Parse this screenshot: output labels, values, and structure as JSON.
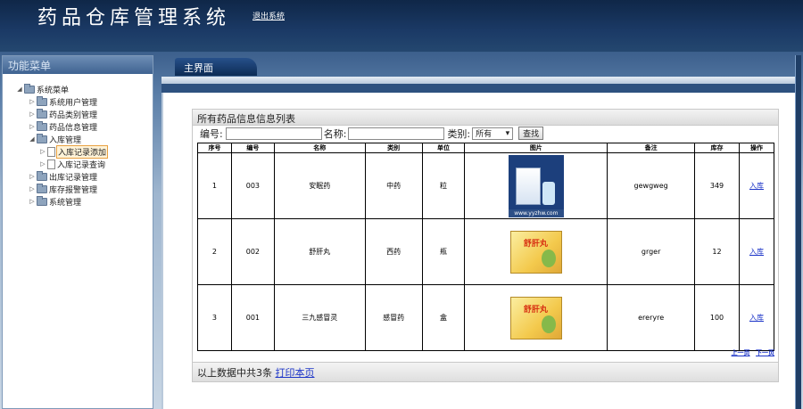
{
  "header": {
    "app_title": "药品仓库管理系统",
    "logout_label": "退出系统"
  },
  "sidebar": {
    "title": "功能菜单",
    "items": [
      {
        "label": "系统菜单"
      },
      {
        "label": "系统用户管理"
      },
      {
        "label": "药品类别管理"
      },
      {
        "label": "药品信息管理"
      },
      {
        "label": "入库管理"
      },
      {
        "label": "入库记录添加"
      },
      {
        "label": "入库记录查询"
      },
      {
        "label": "出库记录管理"
      },
      {
        "label": "库存报警管理"
      },
      {
        "label": "系统管理"
      }
    ]
  },
  "main": {
    "tab_label": "主界面",
    "list_title": "所有药品信息信息列表",
    "search": {
      "code_label": "编号:",
      "code_value": "",
      "name_label": "名称:",
      "name_value": "",
      "category_label": "类别:",
      "category_selected": "所有",
      "search_button": "查找"
    },
    "columns": [
      "序号",
      "编号",
      "名称",
      "类别",
      "单位",
      "图片",
      "备注",
      "库存",
      "操作"
    ],
    "rows": [
      {
        "index": "1",
        "code": "003",
        "name": "安眠药",
        "category": "中药",
        "unit": "粒",
        "image": "medicine-box-image",
        "note": "gewgweg",
        "stock": "349",
        "action": "入库"
      },
      {
        "index": "2",
        "code": "002",
        "name": "舒肝丸",
        "category": "西药",
        "unit": "瓶",
        "image": "medicine-box-image",
        "note": "grger",
        "stock": "12",
        "action": "入库"
      },
      {
        "index": "3",
        "code": "001",
        "name": "三九感冒灵",
        "category": "感冒药",
        "unit": "盒",
        "image": "medicine-box-image",
        "note": "ereryre",
        "stock": "100",
        "action": "入库"
      }
    ],
    "image_texts": {
      "watermark": "www.yyzhw.com",
      "box_label": "舒肝丸"
    },
    "pager": {
      "prev": "上一页",
      "next": "下一页"
    },
    "footer": {
      "summary": "以上数据中共3条",
      "print_link": "打印本页"
    }
  },
  "colors": {
    "header_bg": "#0f2748",
    "link": "#1d35c8",
    "tab_bg": "#0d2c55"
  }
}
